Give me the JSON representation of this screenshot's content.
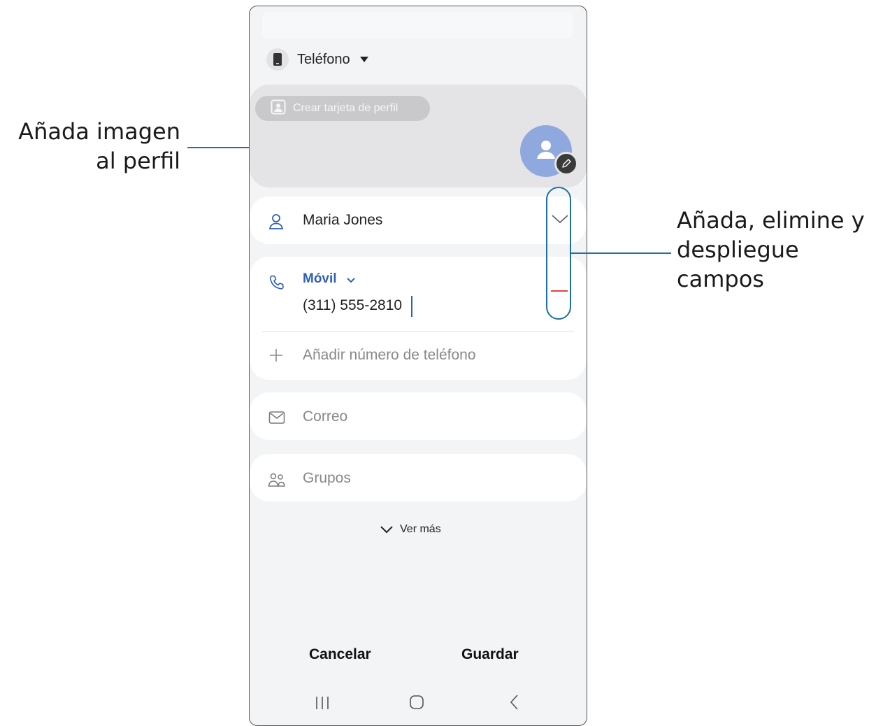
{
  "callouts": {
    "left": {
      "line1": "Añada imagen",
      "line2": "al perfil"
    },
    "right": {
      "line1": "Añada, elimine y",
      "line2": "despliegue",
      "line3": "campos"
    }
  },
  "account": {
    "label": "Teléfono"
  },
  "profile": {
    "chip_label": "Crear tarjeta de perfil"
  },
  "name": {
    "value": "Maria Jones"
  },
  "phone": {
    "type_label": "Móvil",
    "number": "(311) 555-2810",
    "add_label": "Añadir número de teléfono"
  },
  "email": {
    "placeholder": "Correo"
  },
  "groups": {
    "label": "Grupos"
  },
  "more": {
    "label": "Ver más"
  },
  "footer": {
    "cancel": "Cancelar",
    "save": "Guardar"
  },
  "colors": {
    "accent_blue": "#2f5fb8",
    "callout_line": "#1f6fa3",
    "remove_red": "#e0453a",
    "avatar": "#8fa8dd"
  }
}
